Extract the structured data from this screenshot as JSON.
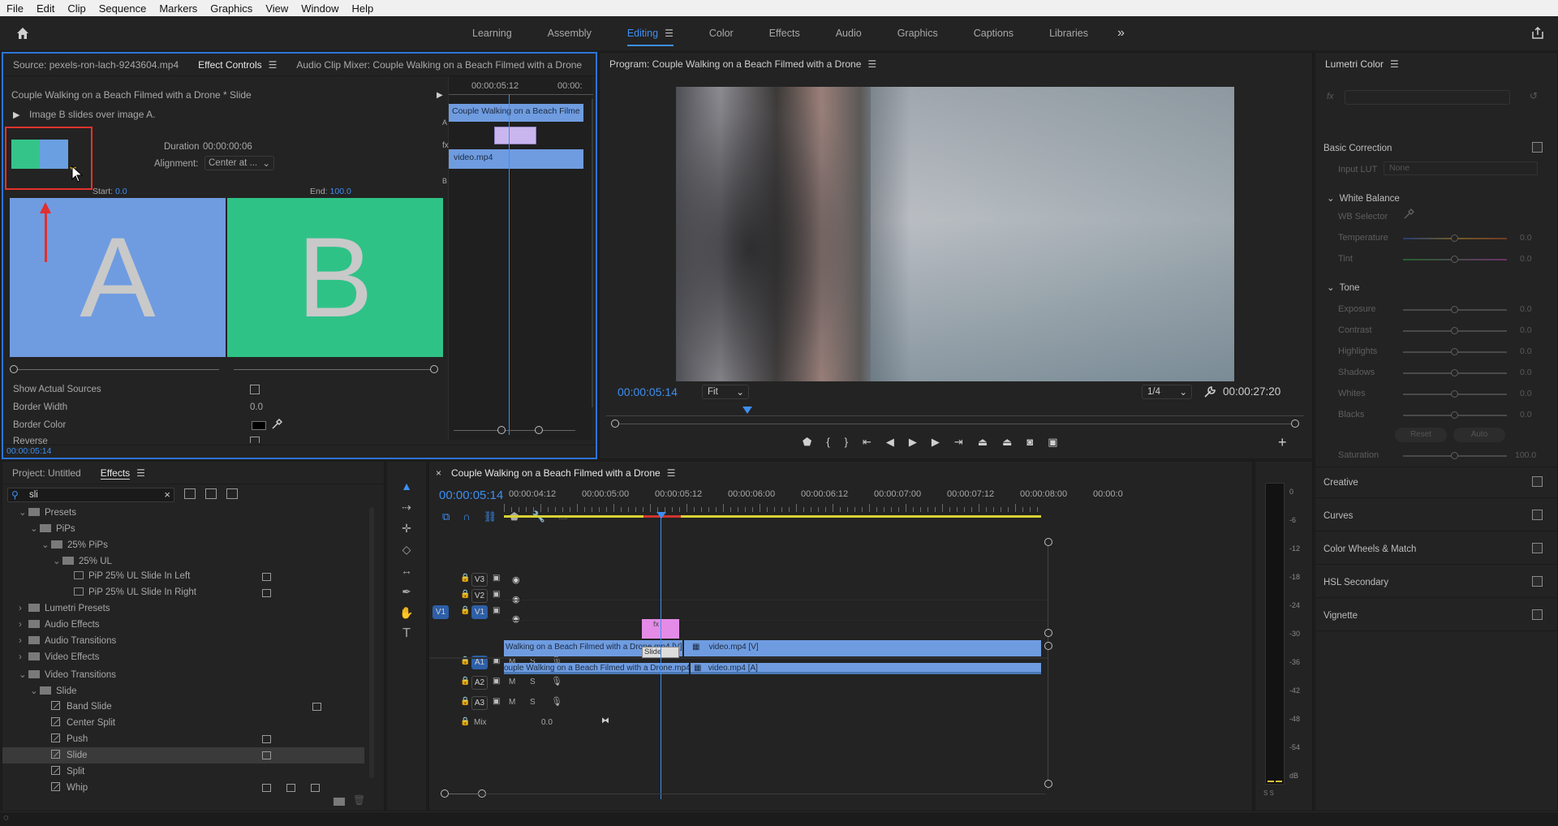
{
  "menu": [
    "File",
    "Edit",
    "Clip",
    "Sequence",
    "Markers",
    "Graphics",
    "View",
    "Window",
    "Help"
  ],
  "workspaces": {
    "tabs": [
      "Learning",
      "Assembly",
      "Editing",
      "Color",
      "Effects",
      "Audio",
      "Graphics",
      "Captions",
      "Libraries"
    ],
    "active": "Editing"
  },
  "effect_controls": {
    "tabs": [
      "Source: pexels-ron-lach-9243604.mp4",
      "Effect Controls",
      "Audio Clip Mixer: Couple Walking on a Beach Filmed with a Drone"
    ],
    "sequence_label": "Couple Walking on a Beach Filmed with a Drone * Slide",
    "description": "Image B slides over image A.",
    "duration_label": "Duration",
    "duration_value": "00:00:00:06",
    "alignment_label": "Alignment:",
    "alignment_value": "Center at ...",
    "start_label": "Start:",
    "start_value": "0.0",
    "end_label": "End:",
    "end_value": "100.0",
    "preview_a": "A",
    "preview_b": "B",
    "props": {
      "show_sources": "Show Actual Sources",
      "border_width": "Border Width",
      "border_width_value": "0.0",
      "border_color": "Border Color",
      "reverse": "Reverse"
    },
    "timecode": "00:00:05:14",
    "mini_timeline": {
      "ruler_a": "00:00:05:12",
      "ruler_b": "00:00:",
      "track_a": "A",
      "track_b": "B",
      "clip_a": "Couple Walking on a Beach Filme",
      "clip_b": "video.mp4"
    }
  },
  "program": {
    "title": "Program: Couple Walking on a Beach Filmed with a Drone",
    "timecode": "00:00:05:14",
    "fit": "Fit",
    "resolution": "1/4",
    "duration": "00:00:27:20"
  },
  "lumetri": {
    "title": "Lumetri Color",
    "basic_correction": "Basic Correction",
    "input_lut": "Input LUT",
    "input_lut_value": "None",
    "white_balance": "White Balance",
    "wb_selector": "WB Selector",
    "wb_sliders": [
      {
        "label": "Temperature",
        "value": "0.0"
      },
      {
        "label": "Tint",
        "value": "0.0"
      }
    ],
    "tone": "Tone",
    "tone_sliders": [
      {
        "label": "Exposure",
        "value": "0.0"
      },
      {
        "label": "Contrast",
        "value": "0.0"
      },
      {
        "label": "Highlights",
        "value": "0.0"
      },
      {
        "label": "Shadows",
        "value": "0.0"
      },
      {
        "label": "Whites",
        "value": "0.0"
      },
      {
        "label": "Blacks",
        "value": "0.0"
      }
    ],
    "reset": "Reset",
    "auto": "Auto",
    "saturation": "Saturation",
    "saturation_value": "100.0",
    "sections": [
      "Creative",
      "Curves",
      "Color Wheels & Match",
      "HSL Secondary",
      "Vignette"
    ]
  },
  "effects_panel": {
    "tabs": [
      "Project: Untitled",
      "Effects"
    ],
    "search_value": "sli",
    "tree": [
      {
        "label": "Presets",
        "indent": 1,
        "type": "folder"
      },
      {
        "label": "PiPs",
        "indent": 2,
        "type": "folder"
      },
      {
        "label": "25% PiPs",
        "indent": 3,
        "type": "folder"
      },
      {
        "label": "25% UL",
        "indent": 4,
        "type": "folder"
      },
      {
        "label": "PiP 25% UL Slide In Left",
        "indent": 5,
        "type": "preset"
      },
      {
        "label": "PiP 25% UL Slide In Right",
        "indent": 5,
        "type": "preset"
      },
      {
        "label": "Lumetri Presets",
        "indent": 1,
        "type": "folder"
      },
      {
        "label": "Audio Effects",
        "indent": 1,
        "type": "folder"
      },
      {
        "label": "Audio Transitions",
        "indent": 1,
        "type": "folder"
      },
      {
        "label": "Video Effects",
        "indent": 1,
        "type": "folder"
      },
      {
        "label": "Video Transitions",
        "indent": 1,
        "type": "folder"
      },
      {
        "label": "Slide",
        "indent": 2,
        "type": "folder"
      },
      {
        "label": "Band Slide",
        "indent": 3,
        "type": "fx"
      },
      {
        "label": "Center Split",
        "indent": 3,
        "type": "fx"
      },
      {
        "label": "Push",
        "indent": 3,
        "type": "fx"
      },
      {
        "label": "Slide",
        "indent": 3,
        "type": "fx"
      },
      {
        "label": "Split",
        "indent": 3,
        "type": "fx"
      },
      {
        "label": "Whip",
        "indent": 3,
        "type": "fx"
      }
    ]
  },
  "timeline": {
    "title": "Couple Walking on a Beach Filmed with a Drone",
    "timecode": "00:00:05:14",
    "ruler": [
      "00:00:04:12",
      "00:00:05:00",
      "00:00:05:12",
      "00:00:06:00",
      "00:00:06:12",
      "00:00:07:00",
      "00:00:07:12",
      "00:00:08:00",
      "00:00:0"
    ],
    "video_tracks": [
      "V3",
      "V2",
      "V1"
    ],
    "audio_tracks": [
      "A1",
      "A2",
      "A3"
    ],
    "source_v": "V1",
    "source_a": "A1",
    "mute": "M",
    "solo": "S",
    "mix_label": "Mix",
    "mix_value": "0.0",
    "clips": {
      "v1_left": "Walking on a Beach Filmed with a Drone.mp4 [V]",
      "v1_right": "video.mp4 [V]",
      "a1_left": "ouple Walking on a Beach Filmed with a Drone.mp4 [A]",
      "a1_right": "video.mp4 [A]",
      "transition": "Slide",
      "fx": "fx"
    }
  },
  "meter": {
    "labels": [
      "0",
      "-6",
      "-12",
      "-18",
      "-24",
      "-30",
      "-36",
      "-42",
      "-48",
      "-54",
      "dB"
    ],
    "foot": "S S"
  },
  "colors": {
    "accent": "#3d8ff0",
    "clip_blue": "#6f9ce0",
    "transition_pink": "#e48be8",
    "highlight_red": "#e5322d"
  }
}
